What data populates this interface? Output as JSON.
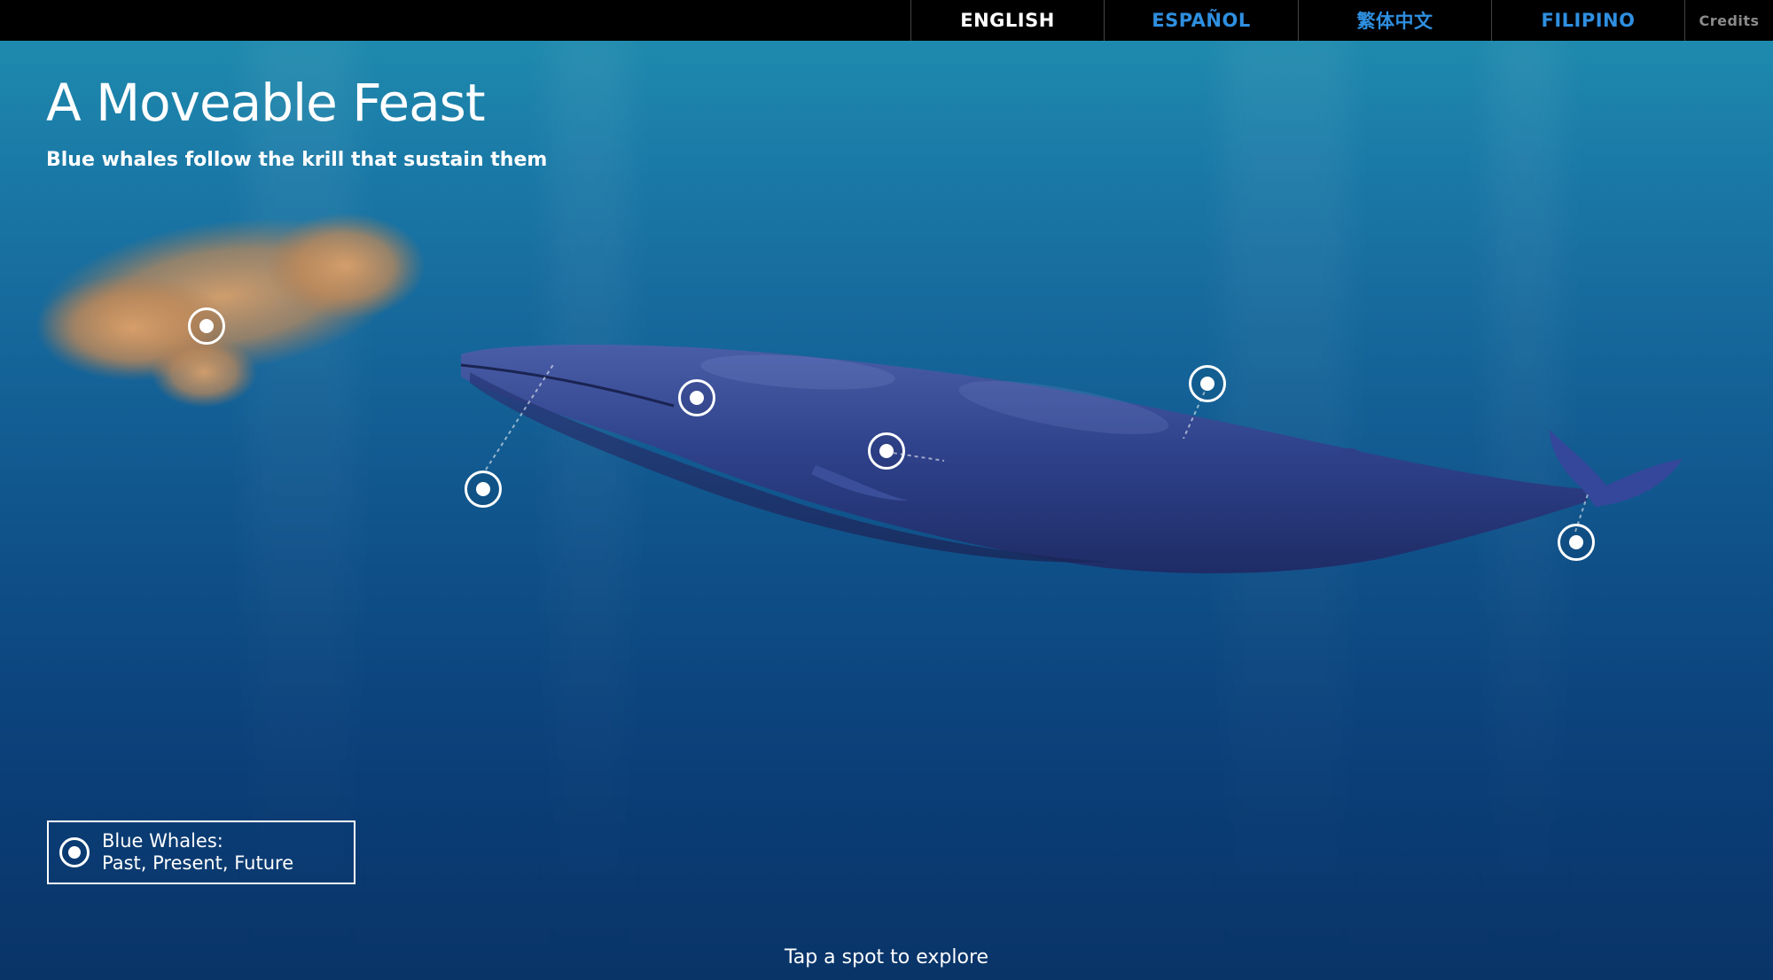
{
  "nav": {
    "languages": [
      {
        "label": "ENGLISH",
        "active": true
      },
      {
        "label": "ESPAÑOL",
        "active": false
      },
      {
        "label": "繁体中文",
        "active": false
      },
      {
        "label": "FILIPINO",
        "active": false
      }
    ],
    "credits_label": "Credits"
  },
  "header": {
    "title": "A Moveable Feast",
    "subtitle": "Blue whales follow the krill that sustain them"
  },
  "story_link": {
    "line1": "Blue Whales:",
    "line2": "Past, Present, Future"
  },
  "hint": "Tap a spot to explore",
  "colors": {
    "nav_background": "#000000",
    "nav_link": "#2f8fe0",
    "nav_active": "#ffffff",
    "credits": "#8a8a8a",
    "ocean_top": "#1f8fb0",
    "ocean_bottom": "#093468",
    "whale": "#2b3f86",
    "krill": "#c9955a"
  },
  "hotspot_count": 7
}
